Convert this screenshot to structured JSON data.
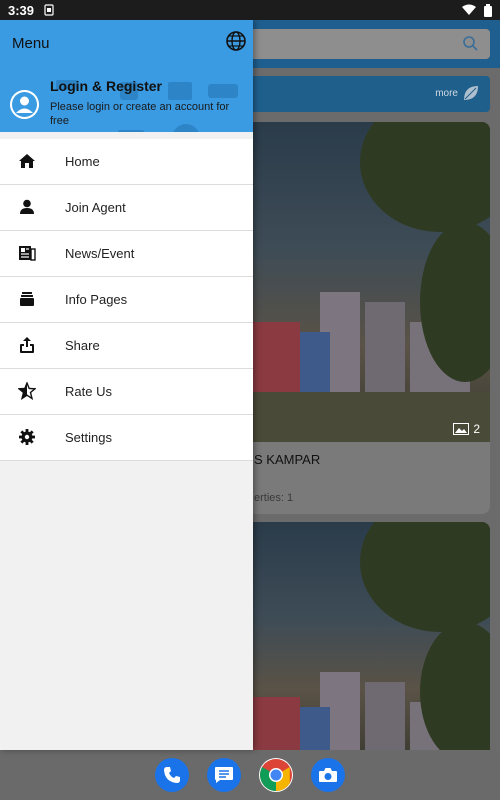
{
  "status_bar": {
    "time": "3:39"
  },
  "background": {
    "banner_more": "more",
    "card1": {
      "title": "S KAMPAR",
      "sub": "erties: 1",
      "image_count": "2"
    }
  },
  "drawer": {
    "header": {
      "title": "Menu",
      "login_title": "Login & Register",
      "login_sub": "Please login or create an account for free"
    },
    "items": [
      {
        "label": "Home",
        "icon": "home-icon"
      },
      {
        "label": "Join Agent",
        "icon": "person-icon"
      },
      {
        "label": "News/Event",
        "icon": "news-icon"
      },
      {
        "label": "Info Pages",
        "icon": "info-pages-icon"
      },
      {
        "label": "Share",
        "icon": "share-icon"
      },
      {
        "label": "Rate Us",
        "icon": "rate-star-icon"
      },
      {
        "label": "Settings",
        "icon": "gear-icon"
      }
    ]
  },
  "colors": {
    "drawer_header": "#3a9be3",
    "app_primary": "#1e5f8f"
  },
  "dock": [
    "phone-icon",
    "messages-icon",
    "chrome-icon",
    "camera-icon"
  ]
}
